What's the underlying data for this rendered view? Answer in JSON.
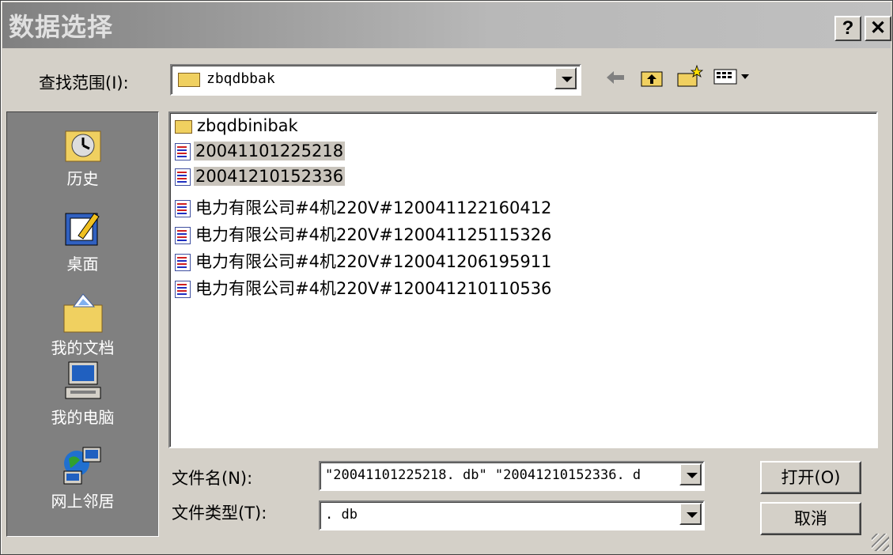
{
  "window": {
    "title": "数据选择",
    "help_label": "?",
    "close_label": "✕"
  },
  "lookin": {
    "label": "查找范围(I):",
    "value": "zbqdbbak"
  },
  "toolbar": {
    "back_icon": "back-arrow-icon",
    "up_icon": "folder-up-icon",
    "new_icon": "new-folder-icon",
    "views_icon": "view-menu-icon"
  },
  "places": [
    {
      "label": "历史",
      "icon": "history-icon"
    },
    {
      "label": "桌面",
      "icon": "desktop-icon"
    },
    {
      "label": "我的文档",
      "icon": "my-documents-icon"
    },
    {
      "label": "我的电脑",
      "icon": "my-computer-icon"
    },
    {
      "label": "网上邻居",
      "icon": "network-neighborhood-icon"
    }
  ],
  "files": [
    {
      "name": "zbqdbinibak",
      "type": "folder",
      "selected": false
    },
    {
      "name": "20041101225218",
      "type": "file",
      "selected": true
    },
    {
      "name": "20041210152336",
      "type": "file",
      "selected": true
    },
    {
      "name": "电力有限公司#4机220V#120041122160412",
      "type": "file",
      "selected": false
    },
    {
      "name": "电力有限公司#4机220V#120041125115326",
      "type": "file",
      "selected": false
    },
    {
      "name": "电力有限公司#4机220V#120041206195911",
      "type": "file",
      "selected": false
    },
    {
      "name": "电力有限公司#4机220V#120041210110536",
      "type": "file",
      "selected": false
    }
  ],
  "filename": {
    "label": "文件名(N):",
    "value": "\"20041101225218. db\" \"20041210152336. d"
  },
  "filetype": {
    "label": "文件类型(T):",
    "value": ". db"
  },
  "buttons": {
    "open": "打开(O)",
    "cancel": "取消"
  }
}
